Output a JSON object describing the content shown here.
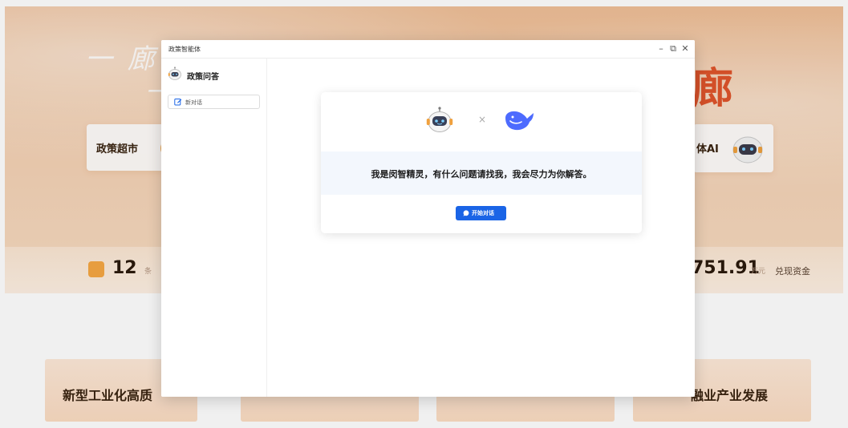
{
  "background": {
    "calligraphy_line1": "一 廊 通",
    "calligraphy_line2": "一",
    "big_title_fragment": "廊",
    "card_left_label": "政策超市",
    "card_right_label": "体AI",
    "stat_left_value": "12",
    "stat_left_unit": "条",
    "stat_right_value": "751.91",
    "stat_right_unit": "万元",
    "stat_right_label": "兑现资金",
    "tile_left_label": "新型工业化高质",
    "tile_right_label": "融业产业发展"
  },
  "modal": {
    "window_title": "政策智能体",
    "controls": {
      "minimize": "–",
      "maximize": "⧉",
      "close": "✕"
    },
    "sidebar": {
      "agent_name": "政策问答",
      "new_chat_label": "新对话"
    },
    "welcome": {
      "times_sign": "×",
      "message": "我是闵智精灵，有什么问题请找我，我会尽力为你解答。",
      "start_button_label": "开始对话"
    }
  },
  "colors": {
    "accent_blue": "#1a64e6",
    "banner_title_red": "#e0542b",
    "whale_blue": "#4d6bfe"
  },
  "icons": [
    "robot-icon",
    "whale-icon",
    "edit-icon",
    "chat-bubble-icon",
    "minimize-icon",
    "maximize-icon",
    "close-icon"
  ]
}
